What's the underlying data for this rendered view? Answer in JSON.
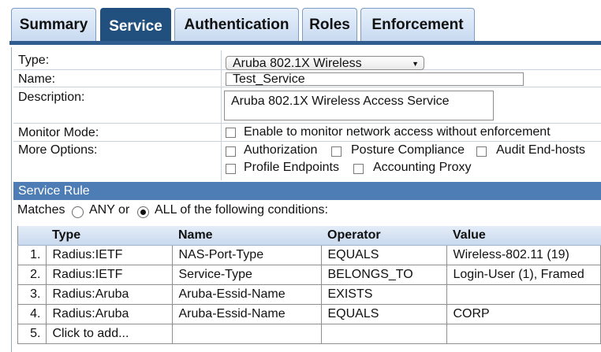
{
  "tabs": [
    "Summary",
    "Service",
    "Authentication",
    "Roles",
    "Enforcement"
  ],
  "active_tab": "Service",
  "form": {
    "type_label": "Type:",
    "type_value": "Aruba 802.1X Wireless",
    "name_label": "Name:",
    "name_value": "Test_Service",
    "description_label": "Description:",
    "description_value": "Aruba 802.1X Wireless Access Service",
    "monitor_label": "Monitor Mode:",
    "monitor_option": "Enable to monitor network access without enforcement",
    "more_label": "More Options:",
    "more_options": [
      "Authorization",
      "Posture Compliance",
      "Audit End-hosts",
      "Profile Endpoints",
      "Accounting Proxy"
    ]
  },
  "service_rule": {
    "header": "Service Rule",
    "matches_prefix": "Matches",
    "option_any": "ANY or",
    "option_all": "ALL of the following conditions:",
    "selected": "ALL",
    "columns": [
      "Type",
      "Name",
      "Operator",
      "Value"
    ],
    "rows": [
      {
        "num": "1.",
        "type": "Radius:IETF",
        "name": "NAS-Port-Type",
        "operator": "EQUALS",
        "value": "Wireless-802.11 (19)"
      },
      {
        "num": "2.",
        "type": "Radius:IETF",
        "name": "Service-Type",
        "operator": "BELONGS_TO",
        "value": "Login-User (1), Framed"
      },
      {
        "num": "3.",
        "type": "Radius:Aruba",
        "name": "Aruba-Essid-Name",
        "operator": "EXISTS",
        "value": ""
      },
      {
        "num": "4.",
        "type": "Radius:Aruba",
        "name": "Aruba-Essid-Name",
        "operator": "EQUALS",
        "value": "CORP"
      },
      {
        "num": "5.",
        "type": "Click to add...",
        "name": "",
        "operator": "",
        "value": ""
      }
    ]
  }
}
